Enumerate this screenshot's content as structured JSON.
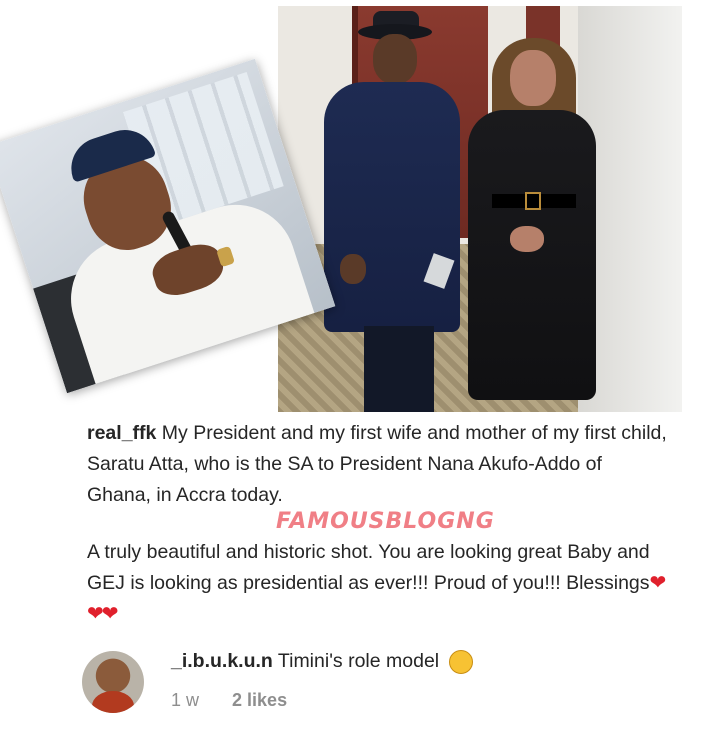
{
  "post": {
    "username": "real_ffk",
    "caption_part1": "My President and my first wife and mother of my first child, Saratu Atta, who is the SA to President Nana Akufo-Addo of Ghana, in Accra today.",
    "caption_part2": "A truly beautiful and historic shot. You are looking great Baby and GEJ is looking as presidential as ever!!! Proud of you!!! Blessings",
    "hearts": "❤❤❤",
    "watermark": "FAMOUSBLOGNG"
  },
  "comment": {
    "username": "_i.b.u.k.u.n",
    "text": "Timini's role model",
    "emoji": "😂",
    "time": "1 w",
    "likes": "2 likes"
  }
}
